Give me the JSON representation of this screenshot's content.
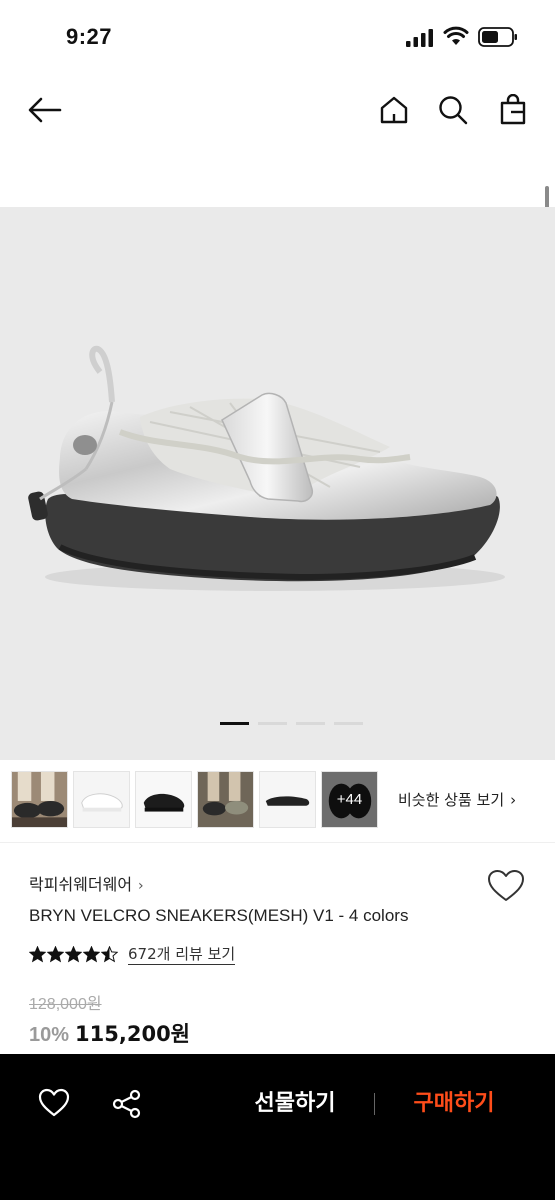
{
  "status_bar": {
    "time": "9:27"
  },
  "nav": {
    "back_icon": "arrow-left-icon",
    "home_icon": "home-icon",
    "search_icon": "search-icon",
    "cart_icon": "shopping-bag-icon"
  },
  "gallery": {
    "image_count_indicator": "1",
    "thumbnails": [
      {
        "icon": "model-photo-1"
      },
      {
        "icon": "white-shoe-photo"
      },
      {
        "icon": "black-shoe-photo"
      },
      {
        "icon": "model-photo-2"
      },
      {
        "icon": "black-flat-photo"
      },
      {
        "icon": "black-pair-photo",
        "overlay_label": "+44"
      }
    ],
    "similar_link_label": "비슷한 상품 보기",
    "similar_link_chevron": "›"
  },
  "product": {
    "brand": "락피쉬웨더웨어",
    "brand_chevron": "›",
    "title": "BRYN VELCRO SNEAKERS(MESH) V1 - 4 colors",
    "rating": 4.5,
    "review_link": "672개 리뷰 보기",
    "original_price": "128,000원",
    "discount": "10%",
    "final_price": "115,200원"
  },
  "bottom_bar": {
    "gift_label": "선물하기",
    "buy_label": "구매하기",
    "buy_color": "#ff4d1a"
  }
}
